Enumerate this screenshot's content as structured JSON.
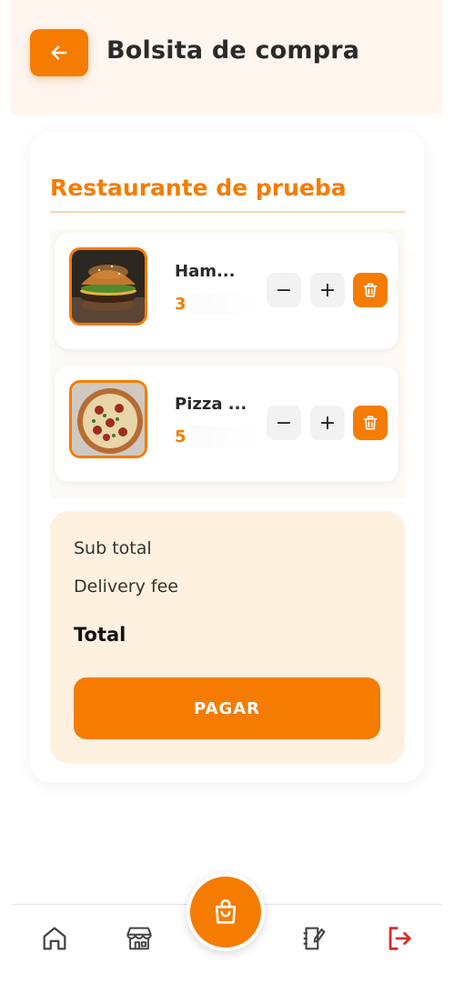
{
  "header": {
    "title": "Bolsita de compra"
  },
  "restaurant": {
    "name": "Restaurante de prueba"
  },
  "items": [
    {
      "name": "Ham...",
      "quantity": "3",
      "image": "hamburger-photo"
    },
    {
      "name": "Pizza ...",
      "quantity": "5",
      "image": "pizza-photo"
    }
  ],
  "controls": {
    "minus": "−",
    "plus": "+"
  },
  "summary": {
    "subtotal_label": "Sub total",
    "delivery_label": "Delivery fee",
    "total_label": "Total",
    "pay_label": "PAGAR"
  },
  "nav": {
    "items": [
      "home-icon",
      "store-icon",
      "bag-icon",
      "notebook-icon",
      "logout-icon"
    ]
  },
  "colors": {
    "accent": "#f57c00",
    "header_bg": "#fff6ef",
    "summary_bg": "#fff1df",
    "logout": "#d32f2f"
  }
}
